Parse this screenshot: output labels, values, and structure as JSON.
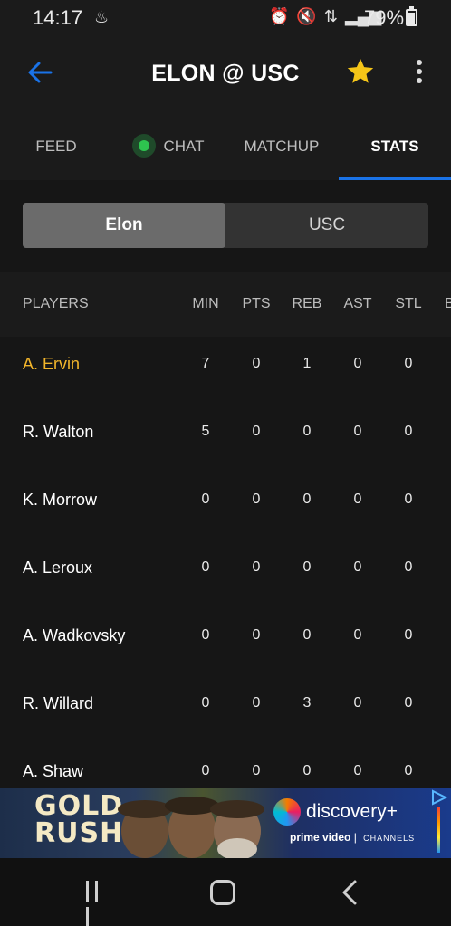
{
  "status_bar": {
    "time": "14:17",
    "battery": "79%",
    "icons": [
      "alarm-icon",
      "mute-icon",
      "data-icon",
      "signal-icon",
      "battery-icon"
    ]
  },
  "app_bar": {
    "title": "ELON @ USC",
    "favorite": true,
    "colors": {
      "accent": "#1a73e8",
      "star": "#f5c518"
    }
  },
  "tabs": [
    {
      "label": "FEED",
      "active": false
    },
    {
      "label": "CHAT",
      "active": false,
      "live": true
    },
    {
      "label": "MATCHUP",
      "active": false
    },
    {
      "label": "STATS",
      "active": true
    }
  ],
  "team_toggle": {
    "options": [
      "Elon",
      "USC"
    ],
    "selected": "Elon"
  },
  "stats_table": {
    "columns": [
      "PLAYERS",
      "MIN",
      "PTS",
      "REB",
      "AST",
      "STL",
      "B"
    ],
    "rows": [
      {
        "player": "A. Ervin",
        "min": "7",
        "pts": "0",
        "reb": "1",
        "ast": "0",
        "stl": "0",
        "highlight": true
      },
      {
        "player": "R. Walton",
        "min": "5",
        "pts": "0",
        "reb": "0",
        "ast": "0",
        "stl": "0"
      },
      {
        "player": "K. Morrow",
        "min": "0",
        "pts": "0",
        "reb": "0",
        "ast": "0",
        "stl": "0"
      },
      {
        "player": "A. Leroux",
        "min": "0",
        "pts": "0",
        "reb": "0",
        "ast": "0",
        "stl": "0"
      },
      {
        "player": "A. Wadkovsky",
        "min": "0",
        "pts": "0",
        "reb": "0",
        "ast": "0",
        "stl": "0"
      },
      {
        "player": "R. Willard",
        "min": "0",
        "pts": "0",
        "reb": "3",
        "ast": "0",
        "stl": "0"
      },
      {
        "player": "A. Shaw",
        "min": "0",
        "pts": "0",
        "reb": "0",
        "ast": "0",
        "stl": "0"
      }
    ],
    "highlight_color": "#f2b52b"
  },
  "ad": {
    "left_title_line1": "GOLD",
    "left_title_line2": "RUSH",
    "brand": "discovery+",
    "partner": "prime video",
    "partner_suffix": "CHANNELS"
  },
  "nav_bar": {
    "buttons": [
      "recents-icon",
      "home-icon",
      "back-icon"
    ]
  }
}
